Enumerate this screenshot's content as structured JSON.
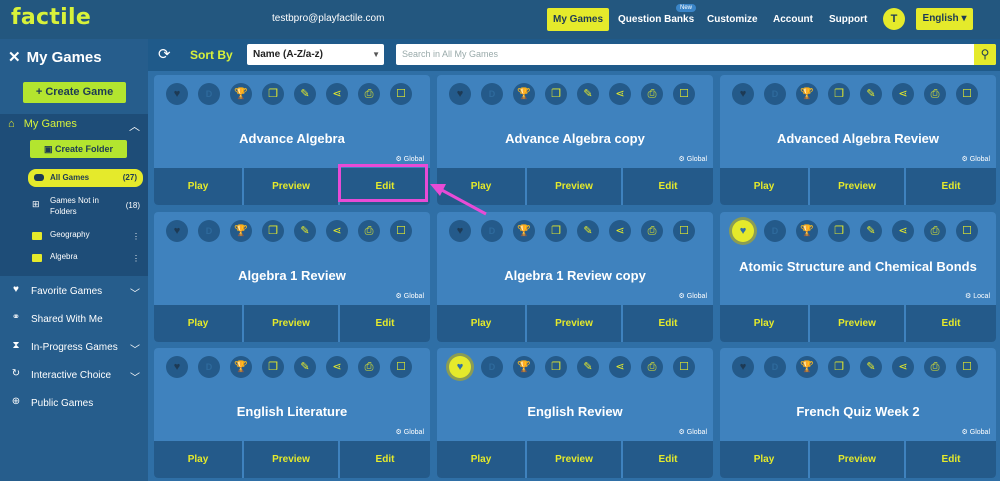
{
  "header": {
    "logo": "factile",
    "email": "testbpro@playfactile.com",
    "nav": [
      "My Games",
      "Question Banks",
      "Customize",
      "Account",
      "Support"
    ],
    "new_badge": "New",
    "avatar": "T",
    "language": "English"
  },
  "sidebar": {
    "title": "My Games",
    "create_game": "Create Game",
    "my_games": "My Games",
    "create_folder": "Create Folder",
    "all_games": "All Games",
    "all_games_count": "(27)",
    "not_in_folders": "Games Not in Folders",
    "not_in_folders_count": "(18)",
    "folders": [
      "Geography",
      "Algebra"
    ],
    "links": [
      "Favorite Games",
      "Shared With Me",
      "In-Progress Games",
      "Interactive Choice",
      "Public Games"
    ]
  },
  "filter": {
    "sort_label": "Sort By",
    "sort_value": "Name (A-Z/a-z)",
    "search_placeholder": "Search in All My Games"
  },
  "card_buttons": {
    "play": "Play",
    "preview": "Preview",
    "edit": "Edit"
  },
  "games": [
    {
      "title": "Advance Algebra",
      "scope": "Global",
      "favorite": false
    },
    {
      "title": "Advance Algebra copy",
      "scope": "Global",
      "favorite": false
    },
    {
      "title": "Advanced Algebra Review",
      "scope": "Global",
      "favorite": false
    },
    {
      "title": "Algebra 1 Review",
      "scope": "Global",
      "favorite": false
    },
    {
      "title": "Algebra 1 Review copy",
      "scope": "Global",
      "favorite": false
    },
    {
      "title": "Atomic Structure and Chemical Bonds",
      "scope": "Local",
      "favorite": true
    },
    {
      "title": "English Literature",
      "scope": "Global",
      "favorite": false
    },
    {
      "title": "English Review",
      "scope": "Global",
      "favorite": true
    },
    {
      "title": "French Quiz Week 2",
      "scope": "Global",
      "favorite": false
    }
  ]
}
